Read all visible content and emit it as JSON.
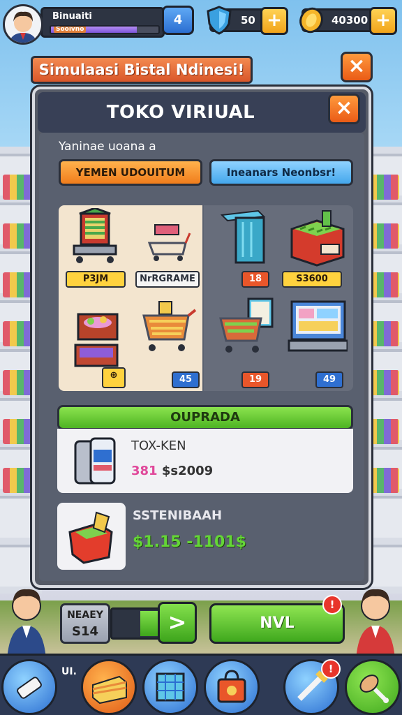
{
  "hud": {
    "player_name": "Binuaiti",
    "xp_label": "Sooivno",
    "xp_fill": 0.8,
    "level_icon_text": "4",
    "shield_value": "50",
    "coin_value": "40300",
    "plus_label": "+"
  },
  "banner": {
    "title": "Simulaasi Bistal Ndinesi!",
    "close_label": "×"
  },
  "panel": {
    "title": "TOKO VIRIUAL",
    "close_label": "×",
    "subtitle": "Yaninae uoana a",
    "tab_primary": "YEMEN UDOUITUM",
    "tab_secondary": "Ineanars Neonbsr!"
  },
  "items": [
    {
      "name": "vending-cart",
      "price": "P3JM",
      "style": "yellow"
    },
    {
      "name": "shopping-cart-small",
      "price": "NrRGRAME",
      "style": "white"
    },
    {
      "name": "display-shelf",
      "price": "18",
      "style": "red"
    },
    {
      "name": "produce-crate",
      "price": "S3600",
      "style": "yellow"
    },
    {
      "name": "fruit-box",
      "price": "",
      "style": "yellow"
    },
    {
      "name": "full-cart",
      "price": "45",
      "style": "blue"
    },
    {
      "name": "cart-with-screen",
      "price": "19",
      "style": "red"
    },
    {
      "name": "kiosk-terminal",
      "price": "49",
      "style": "blue"
    }
  ],
  "section": {
    "title": "OUPRADA",
    "product_name": "TOX-KEN",
    "product_price_pink": "381",
    "product_price_rest": "$s2009",
    "bonus_name": "SSTENIBAAH",
    "bonus_price": "$1.15 -1101$"
  },
  "controls": {
    "stat_label": "NEAEY",
    "stat_value": "S14",
    "next_label": ">",
    "main_button": "NVL",
    "badge_value": "!"
  },
  "bottom_nav": {
    "label": "UI.",
    "alert_badge": "!"
  },
  "colors": {
    "accent_orange": "#f07d1c",
    "accent_green": "#4eb423",
    "panel_bg": "#565b67",
    "header_bg": "#384056"
  }
}
